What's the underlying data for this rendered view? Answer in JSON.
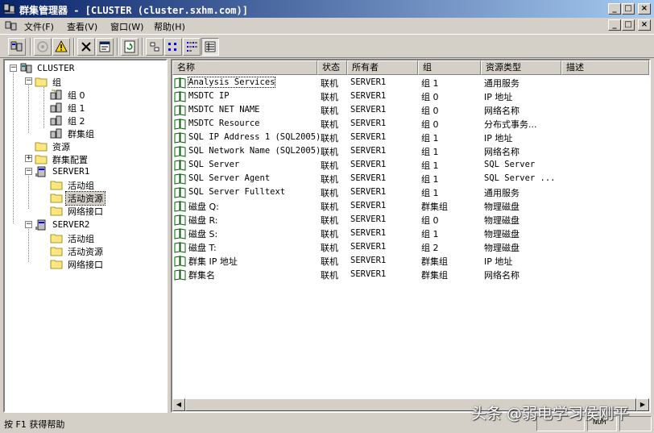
{
  "window": {
    "title": "群集管理器 - [CLUSTER (cluster.sxhm.com)]",
    "minimize": "_",
    "maximize": "□",
    "close": "×"
  },
  "menu": {
    "items": [
      "文件(F)",
      "查看(V)",
      "窗口(W)",
      "帮助(H)"
    ]
  },
  "tree": {
    "root": "CLUSTER",
    "groups": "组",
    "group_items": [
      "组 0",
      "组 1",
      "组 2",
      "群集组"
    ],
    "resources": "资源",
    "cluster_config": "群集配置",
    "server1": "SERVER1",
    "server1_items": [
      "活动组",
      "活动资源",
      "网络接口"
    ],
    "server2": "SERVER2",
    "server2_items": [
      "活动组",
      "活动资源",
      "网络接口"
    ],
    "selected": "活动资源"
  },
  "list": {
    "columns": [
      "名称",
      "状态",
      "所有者",
      "组",
      "资源类型",
      "描述"
    ],
    "rows": [
      {
        "name": "Analysis Services",
        "state": "联机",
        "owner": "SERVER1",
        "group": "组 1",
        "type": "通用服务"
      },
      {
        "name": "MSDTC IP",
        "state": "联机",
        "owner": "SERVER1",
        "group": "组 0",
        "type": "IP 地址"
      },
      {
        "name": "MSDTC NET NAME",
        "state": "联机",
        "owner": "SERVER1",
        "group": "组 0",
        "type": "网络名称"
      },
      {
        "name": "MSDTC Resource",
        "state": "联机",
        "owner": "SERVER1",
        "group": "组 0",
        "type": "分布式事务..."
      },
      {
        "name": "SQL IP Address 1 (SQL2005)",
        "state": "联机",
        "owner": "SERVER1",
        "group": "组 1",
        "type": "IP 地址"
      },
      {
        "name": "SQL Network Name (SQL2005)",
        "state": "联机",
        "owner": "SERVER1",
        "group": "组 1",
        "type": "网络名称"
      },
      {
        "name": "SQL Server",
        "state": "联机",
        "owner": "SERVER1",
        "group": "组 1",
        "type": "SQL Server"
      },
      {
        "name": "SQL Server Agent",
        "state": "联机",
        "owner": "SERVER1",
        "group": "组 1",
        "type": "SQL Server ..."
      },
      {
        "name": "SQL Server Fulltext",
        "state": "联机",
        "owner": "SERVER1",
        "group": "组 1",
        "type": "通用服务"
      },
      {
        "name": "磁盘 Q:",
        "state": "联机",
        "owner": "SERVER1",
        "group": "群集组",
        "type": "物理磁盘"
      },
      {
        "name": "磁盘 R:",
        "state": "联机",
        "owner": "SERVER1",
        "group": "组 0",
        "type": "物理磁盘"
      },
      {
        "name": "磁盘 S:",
        "state": "联机",
        "owner": "SERVER1",
        "group": "组 1",
        "type": "物理磁盘"
      },
      {
        "name": "磁盘 T:",
        "state": "联机",
        "owner": "SERVER1",
        "group": "组 2",
        "type": "物理磁盘"
      },
      {
        "name": "群集 IP 地址",
        "state": "联机",
        "owner": "SERVER1",
        "group": "群集组",
        "type": "IP 地址"
      },
      {
        "name": "群集名",
        "state": "联机",
        "owner": "SERVER1",
        "group": "群集组",
        "type": "网络名称"
      }
    ]
  },
  "status": {
    "help": "按 F1 获得帮助",
    "num": "NUM"
  },
  "watermark": "头条 @弱电学习侯刚平",
  "colors": {
    "title_start": "#0a246a",
    "title_end": "#a6caf0",
    "face": "#d4d0c8"
  }
}
